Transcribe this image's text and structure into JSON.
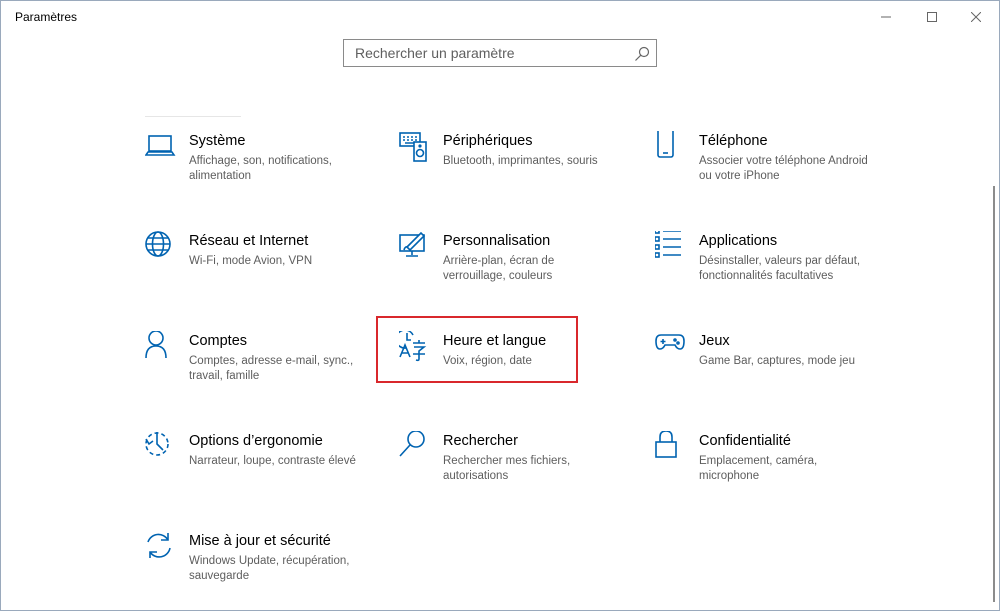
{
  "window": {
    "title": "Paramètres"
  },
  "search": {
    "placeholder": "Rechercher un paramètre"
  },
  "colors": {
    "accent": "#0063b1",
    "highlight": "#d9282c"
  },
  "categories": [
    {
      "name": "Système",
      "desc": "Affichage, son, notifications, alimentation",
      "icon": "laptop-icon"
    },
    {
      "name": "Périphériques",
      "desc": "Bluetooth, imprimantes, souris",
      "icon": "devices-icon"
    },
    {
      "name": "Téléphone",
      "desc": "Associer votre téléphone Android ou votre iPhone",
      "icon": "phone-icon"
    },
    {
      "name": "Réseau et Internet",
      "desc": "Wi-Fi, mode Avion, VPN",
      "icon": "globe-icon"
    },
    {
      "name": "Personnalisation",
      "desc": "Arrière-plan, écran de verrouillage, couleurs",
      "icon": "personalization-icon"
    },
    {
      "name": "Applications",
      "desc": "Désinstaller, valeurs par défaut, fonctionnalités facultatives",
      "icon": "apps-list-icon"
    },
    {
      "name": "Comptes",
      "desc": "Comptes, adresse e-mail, sync., travail, famille",
      "icon": "person-icon"
    },
    {
      "name": "Heure et langue",
      "desc": "Voix, région, date",
      "icon": "time-language-icon"
    },
    {
      "name": "Jeux",
      "desc": "Game Bar, captures, mode jeu",
      "icon": "gamepad-icon"
    },
    {
      "name": "Options d’ergonomie",
      "desc": "Narrateur, loupe, contraste élevé",
      "icon": "ease-of-access-icon"
    },
    {
      "name": "Rechercher",
      "desc": "Rechercher mes fichiers, autorisations",
      "icon": "magnifier-icon"
    },
    {
      "name": "Confidentialité",
      "desc": "Emplacement, caméra, microphone",
      "icon": "lock-icon"
    },
    {
      "name": "Mise à jour et sécurité",
      "desc": "Windows Update, récupération, sauvegarde",
      "icon": "sync-icon"
    }
  ]
}
